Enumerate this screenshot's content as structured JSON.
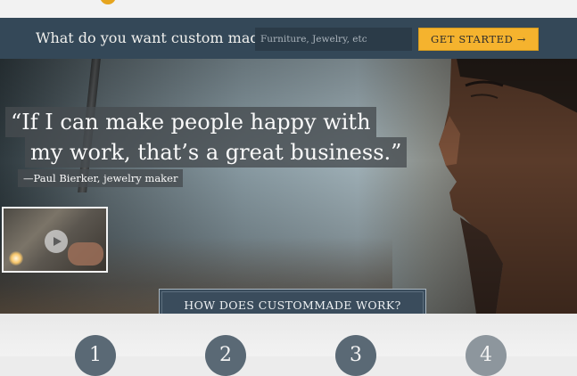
{
  "search": {
    "question": "What do you want custom made?",
    "placeholder": "Furniture, Jewelry, etc",
    "value": "",
    "button_label": "GET STARTED →"
  },
  "hero": {
    "quote_line1": "“If I can make people happy with",
    "quote_line2": "my work, that’s a great business.”",
    "attribution": "—Paul Bierker, jewelry maker",
    "video_icon": "play-icon"
  },
  "how_button_label": "HOW DOES CUSTOMMADE WORK?",
  "steps": [
    {
      "number": "1"
    },
    {
      "number": "2"
    },
    {
      "number": "3"
    },
    {
      "number": "4"
    }
  ],
  "colors": {
    "accent": "#f5b32e",
    "navy": "#344858",
    "step_badge": "#5a6975"
  }
}
